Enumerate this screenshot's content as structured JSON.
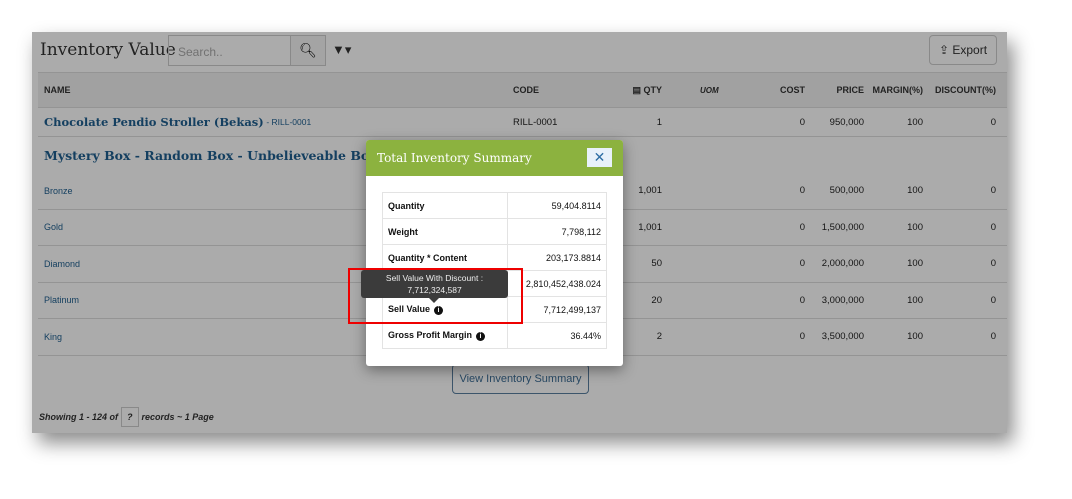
{
  "header": {
    "title": "Inventory Value",
    "search_placeholder": "Search..",
    "export_label": "Export"
  },
  "columns": {
    "name": "NAME",
    "code": "CODE",
    "qty": "QTY",
    "uom": "UOM",
    "cost": "COST",
    "price": "PRICE",
    "margin": "MARGIN(%)",
    "discount": "DISCOUNT(%)"
  },
  "rows": [
    {
      "name": "Chocolate Pendio Stroller (Bekas)",
      "sku": "- RILL-0001",
      "code": "RILL-0001",
      "qty": "1",
      "cost": "0",
      "price": "950,000",
      "margin": "100",
      "discount": "0"
    }
  ],
  "group": {
    "name": "Mystery Box - Random Box - Unbelieveable Box - M",
    "variants": [
      {
        "name": "Bronze",
        "qty": "1,001",
        "cost": "0",
        "price": "500,000",
        "margin": "100",
        "discount": "0"
      },
      {
        "name": "Gold",
        "qty": "1,001",
        "cost": "0",
        "price": "1,500,000",
        "margin": "100",
        "discount": "0"
      },
      {
        "name": "Diamond",
        "qty": "50",
        "cost": "0",
        "price": "2,000,000",
        "margin": "100",
        "discount": "0"
      },
      {
        "name": "Platinum",
        "qty": "20",
        "cost": "0",
        "price": "3,000,000",
        "margin": "100",
        "discount": "0"
      },
      {
        "name": "King",
        "qty": "2",
        "cost": "0",
        "price": "3,500,000",
        "margin": "100",
        "discount": "0"
      }
    ]
  },
  "footer": {
    "prefix": "Showing 1 - 124 of",
    "count": "?",
    "suffix": "records ~ 1 Page"
  },
  "view_summary_label": "View Inventory Summary",
  "modal": {
    "title": "Total Inventory Summary",
    "close": "✕",
    "rows": [
      {
        "label": "Quantity",
        "value": "59,404.8114"
      },
      {
        "label": "Weight",
        "value": "7,798,112"
      },
      {
        "label": "Quantity * Content",
        "value": "203,173.8814"
      },
      {
        "label": "",
        "value": "2,810,452,438.024"
      },
      {
        "label": "Sell Value",
        "value": "7,712,499,137"
      },
      {
        "label": "Gross Profit Margin",
        "value": "36.44%"
      }
    ]
  },
  "tooltip": {
    "label": "Sell Value With Discount :",
    "value": "7,712,324,587"
  }
}
